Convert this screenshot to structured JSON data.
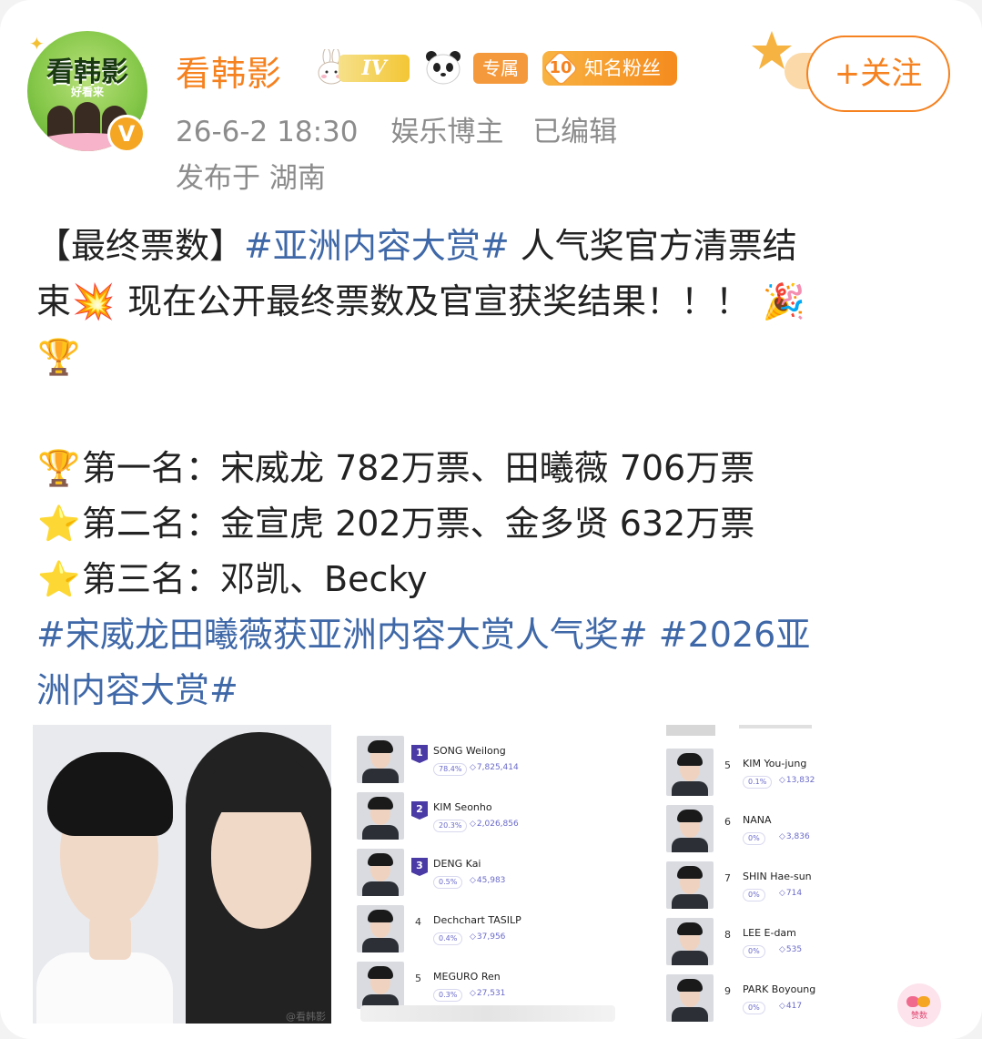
{
  "author": {
    "name": "看韩影",
    "avatar_text": "看韩影",
    "avatar_sub": "好看来",
    "level": "IV",
    "tag": "专属",
    "fan_level": "10",
    "fan_label": "知名粉丝"
  },
  "meta": {
    "time": "26-6-2 18:30",
    "role": "娱乐博主",
    "edited": "已编辑",
    "location": "发布于 湖南"
  },
  "follow_label": "+关注",
  "post": {
    "l1_a": "【最终票数】",
    "l1_tag": "#亚洲内容大赏#",
    "l1_b": " 人气奖官方清票结",
    "l2_a": "束",
    "l2_b": " 现在公开最终票数及官宣获奖结果！！！",
    "line_first": "第一名：宋威龙 782万票、田曦薇 706万票",
    "line_second": "第二名：金宣虎 202万票、金多贤 632万票",
    "line_third": "第三名：邓凯、Becky",
    "tag_a": "#宋威龙田曦薇获亚洲内容大赏人气奖#",
    "tag_b": " #2026亚",
    "tag_c": "洲内容大赏#"
  },
  "emojis": {
    "explosion": "💥",
    "party": "🎉",
    "trophy": "🏆",
    "star": "⭐"
  },
  "photo_watermark": "@看韩影",
  "rankings_left": [
    {
      "rank": "1",
      "name": "SONG Weilong",
      "pct": "78.4%",
      "votes": "7,825,414"
    },
    {
      "rank": "2",
      "name": "KIM Seonho",
      "pct": "20.3%",
      "votes": "2,026,856"
    },
    {
      "rank": "3",
      "name": "DENG Kai",
      "pct": "0.5%",
      "votes": "45,983"
    },
    {
      "rank": "4",
      "name": "Dechchart TASILP",
      "pct": "0.4%",
      "votes": "37,956"
    },
    {
      "rank": "5",
      "name": "MEGURO Ren",
      "pct": "0.3%",
      "votes": "27,531"
    }
  ],
  "rankings_right": [
    {
      "rank": "5",
      "name": "KIM You-jung",
      "pct": "0.1%",
      "votes": "13,832"
    },
    {
      "rank": "6",
      "name": "NANA",
      "pct": "0%",
      "votes": "3,836"
    },
    {
      "rank": "7",
      "name": "SHIN Hae-sun",
      "pct": "0%",
      "votes": "714"
    },
    {
      "rank": "8",
      "name": "LEE E-dam",
      "pct": "0%",
      "votes": "535"
    },
    {
      "rank": "9",
      "name": "PARK Boyoung",
      "pct": "0%",
      "votes": "417"
    }
  ],
  "reaction_label": "赞数",
  "colors": {
    "accent": "#f5811f",
    "hashtag": "#3f68a8",
    "meta": "#8c8c8c",
    "rank_badge": "#4a3aa6"
  }
}
